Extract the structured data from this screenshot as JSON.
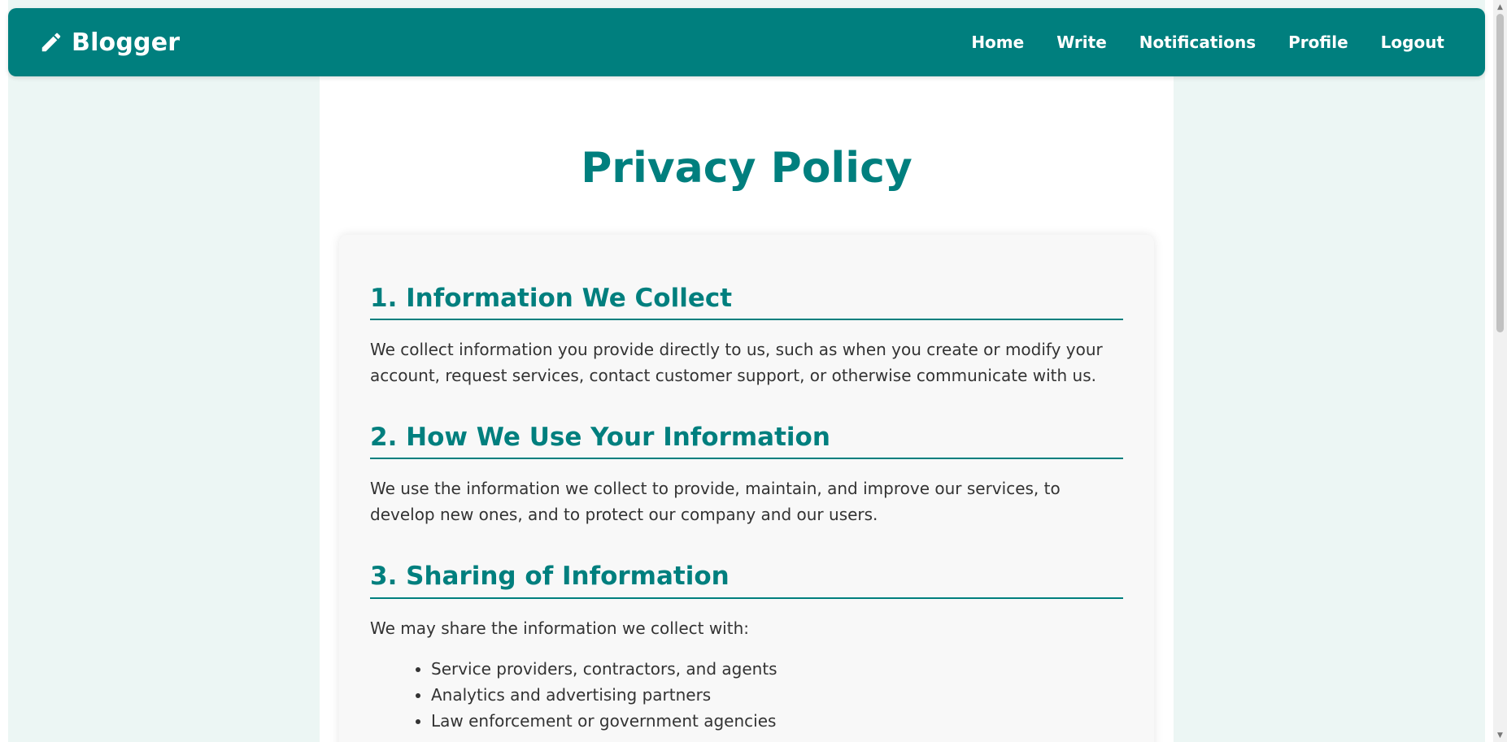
{
  "navbar": {
    "brand": "Blogger",
    "brand_icon": "pencil-icon",
    "links": [
      "Home",
      "Write",
      "Notifications",
      "Profile",
      "Logout"
    ]
  },
  "page": {
    "title": "Privacy Policy"
  },
  "policy": {
    "section1": {
      "heading": "1. Information We Collect",
      "text": "We collect information you provide directly to us, such as when you create or modify your account, request services, contact customer support, or otherwise communicate with us."
    },
    "section2": {
      "heading": "2. How We Use Your Information",
      "text": "We use the information we collect to provide, maintain, and improve our services, to develop new ones, and to protect our company and our users."
    },
    "section3": {
      "heading": "3. Sharing of Information",
      "text": "We may share the information we collect with:",
      "items": [
        "Service providers, contractors, and agents",
        "Analytics and advertising partners",
        "Law enforcement or government agencies"
      ]
    }
  },
  "colors": {
    "primary": "#007f7e",
    "page_background": "#ecf6f4",
    "card_background": "#f8f8f8",
    "text": "#333333"
  }
}
